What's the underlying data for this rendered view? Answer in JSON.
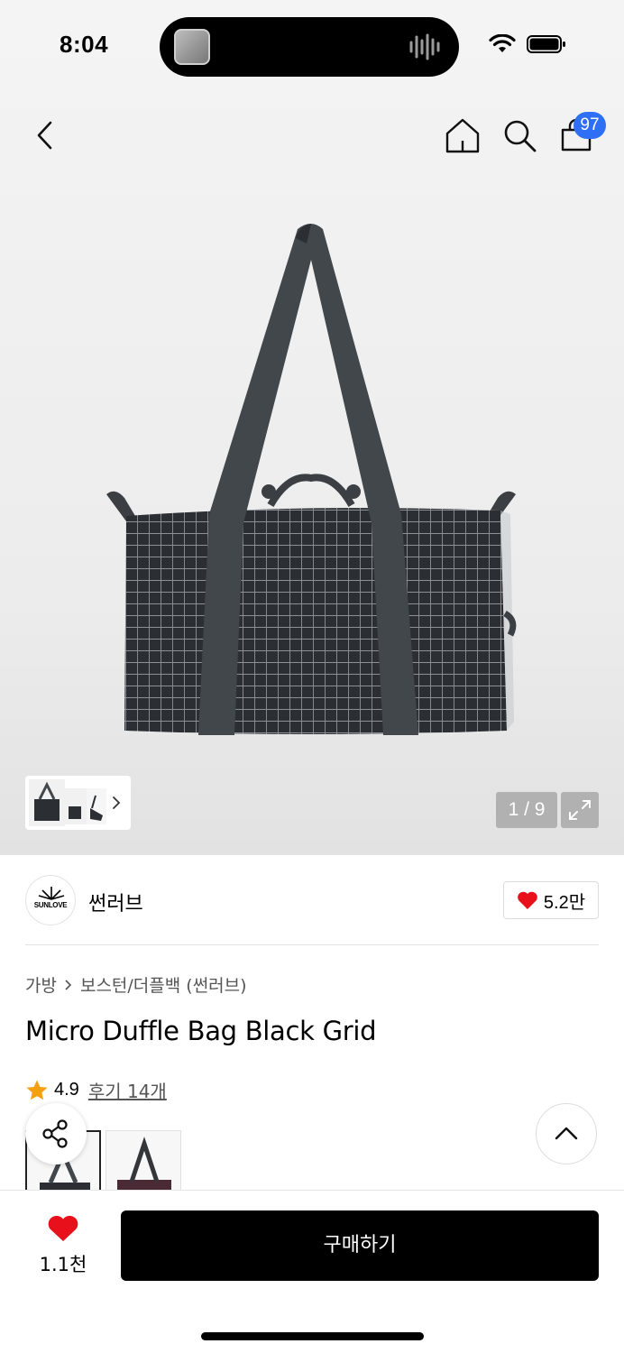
{
  "status_bar": {
    "time": "8:04"
  },
  "header": {
    "cart_count": "97"
  },
  "gallery": {
    "counter": "1 / 9"
  },
  "brand": {
    "logo_text": "SUNLOVE",
    "name": "썬러브",
    "likes": "5.2만"
  },
  "breadcrumb": {
    "category": "가방",
    "subcategory": "보스턴/더플백 (썬러브)"
  },
  "product": {
    "title": "Micro Duffle Bag Black Grid"
  },
  "rating": {
    "score": "4.9",
    "reviews": "후기 14개"
  },
  "bottom_bar": {
    "wish_count": "1.1천",
    "buy_label": "구매하기"
  },
  "colors": {
    "badge": "#2f6ff5",
    "heart": "#e8101a",
    "star": "#f5a10f",
    "buy_button": "#000000"
  }
}
